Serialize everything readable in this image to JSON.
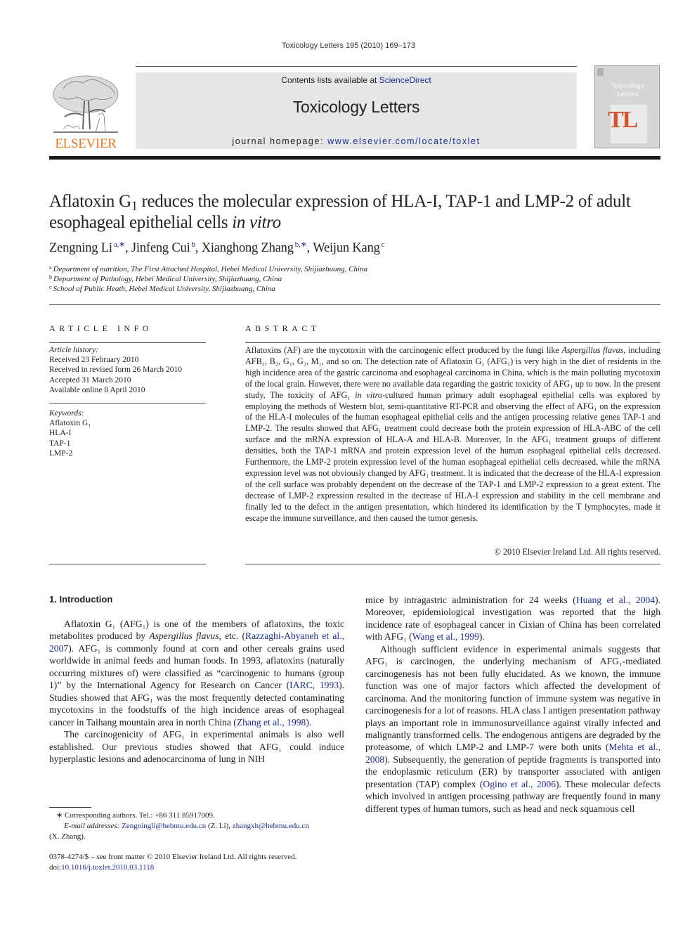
{
  "running_head": "Toxicology Letters 195 (2010) 169–173",
  "publisher": {
    "logo_icon": "elsevier-tree-icon",
    "name": "ELSEVIER",
    "brand_color": "#e87722"
  },
  "masthead": {
    "contents_prefix": "Contents lists available at ",
    "contents_link": "ScienceDirect",
    "journal_title": "Toxicology Letters",
    "homepage_prefix": "journal homepage: ",
    "homepage_url": "www.elsevier.com/locate/toxlet",
    "band_color": "#e6e7e9",
    "link_color": "#1f2f8f"
  },
  "cover": {
    "title_line1": "Toxicology",
    "title_line2": "Letters",
    "monogram": "TL",
    "monogram_color": "#d2552b"
  },
  "article": {
    "title_part1": "Aflatoxin G",
    "title_sub": "1",
    "title_part2": " reduces the molecular expression of HLA-I, TAP-1 and LMP-2 of adult esophageal epithelial cells ",
    "title_italic": "in vitro",
    "authors": [
      {
        "name": "Zengning Li",
        "marks": "a,∗",
        "sep": ", "
      },
      {
        "name": "Jinfeng Cui",
        "marks": "b",
        "sep": ", "
      },
      {
        "name": "Xianghong Zhang",
        "marks": "b,∗",
        "sep": ", "
      },
      {
        "name": "Weijun Kang",
        "marks": "c",
        "sep": ""
      }
    ],
    "affiliations": [
      {
        "mark": "a",
        "text": "Department of nutrition, The First Attached Hospital, Hebei Medical University, Shijiazhuang, China"
      },
      {
        "mark": "b",
        "text": "Department of Pathology, Hebei Medical University, Shijiazhuang, China"
      },
      {
        "mark": "c",
        "text": "School of Public Heath, Hebei Medical University, Shijiazhuang, China"
      }
    ]
  },
  "article_info": {
    "heading": "ARTICLE INFO",
    "history_label": "Article history:",
    "history": [
      "Received 23 February 2010",
      "Received in revised form 26 March 2010",
      "Accepted 31 March 2010",
      "Available online 8 April 2010"
    ],
    "keywords_label": "Keywords:",
    "keywords": [
      "Aflatoxin G₁",
      "HLA-I",
      "TAP-1",
      "LMP-2"
    ]
  },
  "abstract": {
    "heading": "ABSTRACT",
    "segments": [
      {
        "t": "Aflatoxins (AF) are the mycotoxin with the carcinogenic effect produced by the fungi like "
      },
      {
        "t": "Aspergillus flavus",
        "i": true
      },
      {
        "t": ", including AFB₁, B₂, G₁, G₂, M₁, and so on. The detection rate of Aflatoxin G₁ (AFG₁) is very high in the diet of residents in the high incidence area of the gastric carcinoma and esophageal carcinoma in China, which is the main polluting mycotoxin of the local grain. However, there were no available data regarding the gastric toxicity of AFG₁ up to now. In the present study, The toxicity of AFG₁ "
      },
      {
        "t": "in vitro",
        "i": true
      },
      {
        "t": "-cultured human primary adult esophageal epithelial cells was explored by employing the methods of Western blot, semi-quantitative RT-PCR and observing the effect of AFG₁ on the expression of the HLA-I molecules of the human esophageal epithelial cells and the antigen processing relative genes TAP-1 and LMP-2. The results showed that AFG₁ treatment could decrease both the protein expression of HLA-ABC of the cell surface and the mRNA expression of HLA-A and HLA-B. Moreover, In the AFG₁ treatment groups of different densities, both the TAP-1 mRNA and protein expression level of the human esophageal epithelial cells decreased. Furthermore, the LMP-2 protein expression level of the human esophageal epithelial cells decreased, while the mRNA expression level was not obviously changed by AFG₁ treatment. It is indicated that the decrease of the HLA-I expression of the cell surface was probably dependent on the decrease of the TAP-1 and LMP-2 expression to a great extent. The decrease of LMP-2 expression resulted in the decrease of HLA-I expression and stability in the cell membrane and finally led to the defect in the antigen presentation, which hindered its identification by the T lymphocytes, made it escape the immune surveillance, and then caused the tumor genesis."
      }
    ],
    "copyright": "© 2010 Elsevier Ireland Ltd. All rights reserved."
  },
  "introduction": {
    "heading": "1.  Introduction",
    "left_paragraphs": [
      [
        {
          "t": "Aflatoxin G₁ (AFG₁) is one of the members of aflatoxins, the toxic metabolites produced by "
        },
        {
          "t": "Aspergillus flavus",
          "i": true
        },
        {
          "t": ", etc. ("
        },
        {
          "t": "Razzaghi-Abyaneh et al., 2007",
          "link": true
        },
        {
          "t": "). AFG₁ is commonly found at corn and other cereals grains used worldwide in animal feeds and human foods. In 1993, aflatoxins (naturally occurring mixtures of) were classified as “carcinogenic to humans (group 1)” by the International Agency for Research on Cancer ("
        },
        {
          "t": "IARC, 1993",
          "link": true
        },
        {
          "t": "). Studies showed that AFG₁ was the most frequently detected contaminating mycotoxins in the foodstuffs of the high incidence areas of esophageal cancer in Taihang mountain area in north China ("
        },
        {
          "t": "Zhang et al., 1998",
          "link": true
        },
        {
          "t": ")."
        }
      ],
      [
        {
          "t": "The carcinogenicity of AFG₁ in experimental animals is also well established. Our previous studies showed that AFG₁ could induce hyperplastic lesions and adenocarcinoma of lung in NIH"
        }
      ]
    ],
    "right_paragraphs": [
      [
        {
          "t": "mice by intragastric administration for 24 weeks ("
        },
        {
          "t": "Huang et al., 2004",
          "link": true
        },
        {
          "t": "). Moreover, epidemiological investigation was reported that the high incidence rate of esophageal cancer in Cixian of China has been correlated with AFG₁ ("
        },
        {
          "t": "Wang et al., 1999",
          "link": true
        },
        {
          "t": ")."
        }
      ],
      [
        {
          "t": "Although sufficient evidence in experimental animals suggests that AFG₁ is carcinogen, the underlying mechanism of AFG₁-mediated carcinogenesis has not been fully elucidated. As we known, the immune function was one of major factors which affected the development of carcinoma. And the monitoring function of immune system was negative in carcinogenesis for a lot of reasons. HLA class I antigen presentation pathway plays an important role in immunosurveillance against virally infected and malignantly transformed cells. The endogenous antigens are degraded by the proteasome, of which LMP-2 and LMP-7 were both units ("
        },
        {
          "t": "Mehta et al., 2008",
          "link": true
        },
        {
          "t": "). Subsequently, the generation of peptide fragments is transported into the endoplasmic reticulum (ER) by transporter associated with antigen presentation (TAP) complex ("
        },
        {
          "t": "Ogino et al., 2006",
          "link": true
        },
        {
          "t": "). These molecular defects which involved in antigen processing pathway are frequently found in many different types of human tumors, such as head and neck squamous cell"
        }
      ]
    ]
  },
  "footnotes": {
    "corresponding": "∗  Corresponding authors. Tel.: +86 311 85917009.",
    "email_label": "E-mail addresses:",
    "email1": "Zengningli@hebmu.edu.cn",
    "email1_owner": " (Z. Li), ",
    "email2": "zhangxh@hebmu.edu.cn",
    "email2_owner": "(X. Zhang).",
    "issn_line": "0378-4274/$ – see front matter © 2010 Elsevier Ireland Ltd. All rights reserved.",
    "doi_prefix": "doi:",
    "doi": "10.1016/j.toxlet.2010.03.1118"
  }
}
